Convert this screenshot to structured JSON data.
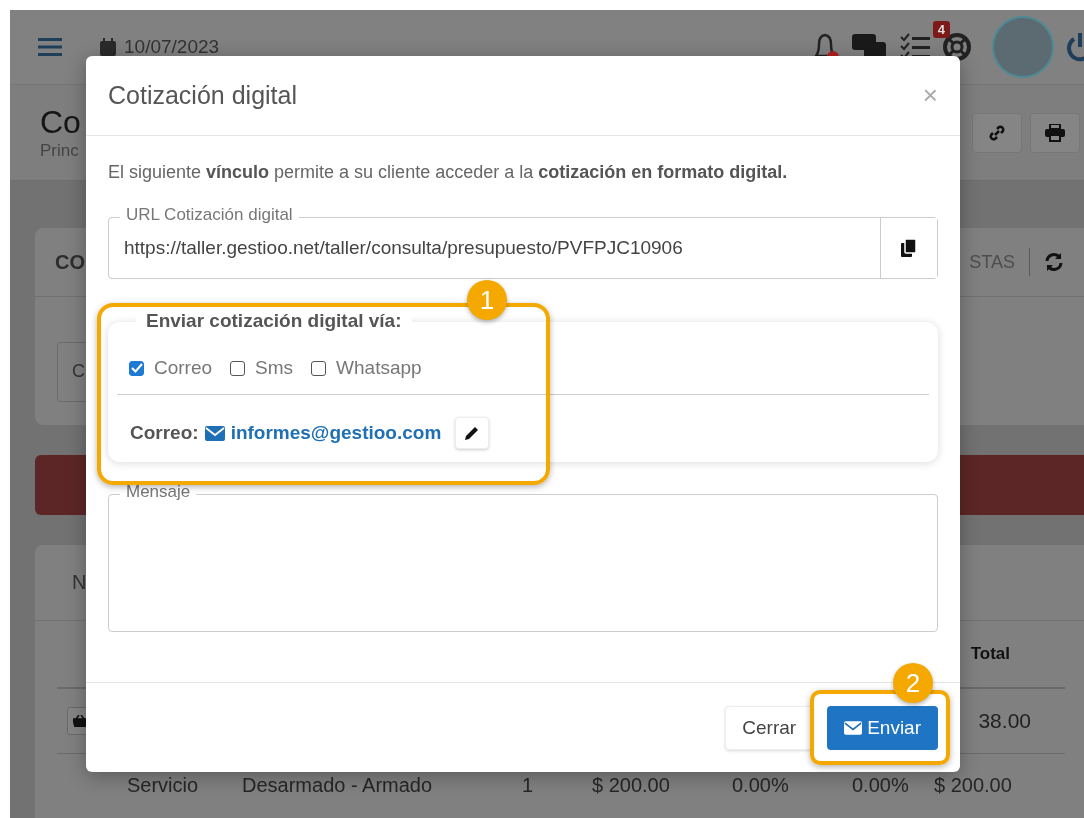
{
  "topbar": {
    "date": "10/07/2023",
    "tasks_badge": "4",
    "bell_alert": true
  },
  "page": {
    "title": "Co",
    "subtitle": "Princ"
  },
  "card": {
    "title": "CO",
    "tab": "STAS",
    "field": "C"
  },
  "table": {
    "heading": "N",
    "total_heading": "Total",
    "first_total": "38.00",
    "row": {
      "cells": [
        "Servicio",
        "Desarmado - Armado",
        "1",
        "$ 200.00",
        "0.00%",
        "0.00%",
        "$ 200.00"
      ]
    }
  },
  "modal": {
    "title": "Cotización digital",
    "close": "×",
    "intro": "El siguiente **vínculo** permite a su cliente acceder a la **cotización en formato digital.**",
    "url_label": "URL Cotización digital",
    "url": "https://taller.gestioo.net/taller/consulta/presupuesto/PVFPJC10906",
    "send_via": {
      "title": "Enviar cotización digital vía:",
      "channels": [
        {
          "label": "Correo",
          "checked": true
        },
        {
          "label": "Sms",
          "checked": false
        },
        {
          "label": "Whatsapp",
          "checked": false
        }
      ],
      "email_label": "Correo:",
      "email": "informes@gestioo.com"
    },
    "message_label": "Mensaje",
    "buttons": [
      {
        "label": "Cerrar",
        "kind": "secondary"
      },
      {
        "label": "Enviar",
        "kind": "primary"
      }
    ]
  },
  "annotations": [
    {
      "number": "1"
    },
    {
      "number": "2"
    }
  ]
}
